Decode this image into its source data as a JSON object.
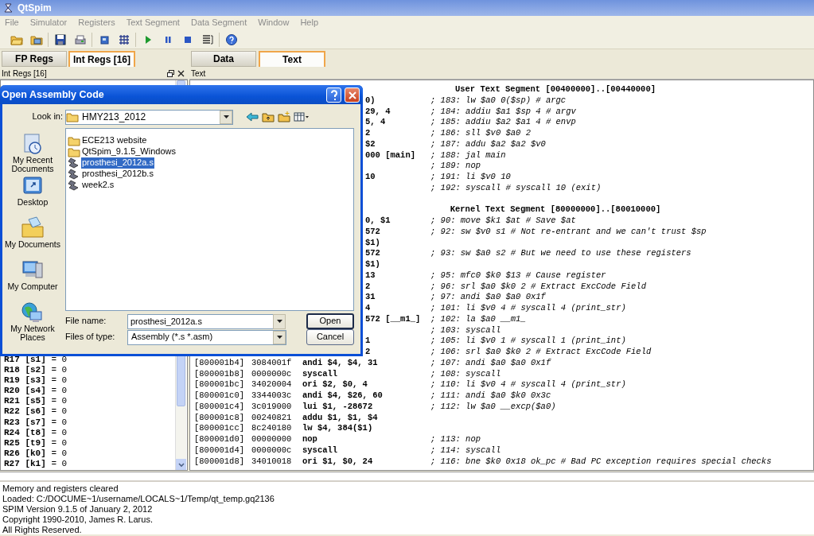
{
  "window": {
    "title": "QtSpim"
  },
  "menu": [
    "File",
    "Simulator",
    "Registers",
    "Text Segment",
    "Data Segment",
    "Window",
    "Help"
  ],
  "register_tabs": [
    {
      "label": "FP Regs",
      "selected": false
    },
    {
      "label": "Int Regs [16]",
      "selected": true
    }
  ],
  "view_tabs": [
    {
      "label": "Data",
      "selected": false
    },
    {
      "label": "Text",
      "selected": true
    }
  ],
  "register_panel": {
    "title": "Int Regs [16]",
    "registers": [
      "**R17 [s1]** = 0",
      "**R18 [s2]** = 0",
      "**R19 [s3]** = 0",
      "**R20 [s4]** = 0",
      "**R21 [s5]** = 0",
      "**R22 [s6]** = 0",
      "**R23 [s7]** = 0",
      "**R24 [t8]** = 0",
      "**R25 [t9]** = 0",
      "**R26 [k0]** = 0",
      "**R27 [k1]** = 0"
    ]
  },
  "text_panel": {
    "title": "Text",
    "lines": [
      {
        "kind": "heading",
        "text": "User Text Segment [00400000]..[00440000]"
      },
      {
        "kind": "partial",
        "fragment": "0)",
        "comment": "; 183: lw $a0 0($sp) # argc"
      },
      {
        "kind": "partial",
        "fragment": "29, 4",
        "comment": "; 184: addiu $a1 $sp 4 # argv"
      },
      {
        "kind": "partial",
        "fragment": "5, 4",
        "comment": "; 185: addiu $a2 $a1 4 # envp"
      },
      {
        "kind": "partial",
        "fragment": "2",
        "comment": "; 186: sll $v0 $a0 2"
      },
      {
        "kind": "partial",
        "fragment": "$2",
        "comment": "; 187: addu $a2 $a2 $v0"
      },
      {
        "kind": "partial",
        "fragment": "000 [main]",
        "comment": "; 188: jal main"
      },
      {
        "kind": "partial",
        "comment": "; 189: nop"
      },
      {
        "kind": "partial",
        "fragment": "10",
        "comment": "; 191: li $v0 10"
      },
      {
        "kind": "partial",
        "comment": "; 192: syscall # syscall 10 (exit)"
      },
      {
        "kind": "blank"
      },
      {
        "kind": "heading",
        "text": "Kernel Text Segment [80000000]..[80010000]"
      },
      {
        "kind": "partial",
        "fragment": "0, $1",
        "comment": "; 90: move $k1 $at # Save $at"
      },
      {
        "kind": "partial",
        "fragment": "572",
        "comment": "; 92: sw $v0 s1 # Not re-entrant and we can't trust $sp"
      },
      {
        "kind": "partial",
        "fragment": "$1)"
      },
      {
        "kind": "partial",
        "fragment": "572",
        "comment": "; 93: sw $a0 s2 # But we need to use these registers"
      },
      {
        "kind": "partial",
        "fragment": "$1)"
      },
      {
        "kind": "partial",
        "fragment": "13",
        "comment": "; 95: mfc0 $k0 $13 # Cause register"
      },
      {
        "kind": "partial",
        "fragment": "2",
        "comment": "; 96: srl $a0 $k0 2 # Extract ExcCode Field"
      },
      {
        "kind": "partial",
        "fragment": "31",
        "comment": "; 97: andi $a0 $a0 0x1f"
      },
      {
        "kind": "partial",
        "fragment": "4",
        "comment": "; 101: li $v0 4 # syscall 4 (print_str)"
      },
      {
        "kind": "partial",
        "fragment": "572 [__m1_]",
        "comment": "; 102: la $a0 __m1_"
      },
      {
        "kind": "partial",
        "comment": "; 103: syscall"
      },
      {
        "kind": "partial",
        "fragment": "1",
        "comment": "; 105: li $v0 1 # syscall 1 (print_int)"
      },
      {
        "kind": "partial",
        "fragment": "2",
        "comment": "; 106: srl $a0 $k0 2 # Extract ExcCode Field"
      },
      {
        "kind": "full",
        "address": "[800001b4]",
        "code": "3084001f",
        "instruction": "andi $4, $4, 31",
        "comment": "; 107: andi $a0 $a0 0x1f"
      },
      {
        "kind": "full",
        "address": "[800001b8]",
        "code": "0000000c",
        "instruction": "syscall",
        "comment": "; 108: syscall"
      },
      {
        "kind": "full",
        "address": "[800001bc]",
        "code": "34020004",
        "instruction": "ori $2, $0, 4",
        "comment": "; 110: li $v0 4 # syscall 4 (print_str)"
      },
      {
        "kind": "full",
        "address": "[800001c0]",
        "code": "3344003c",
        "instruction": "andi $4, $26, 60",
        "comment": "; 111: andi $a0 $k0 0x3c"
      },
      {
        "kind": "full",
        "address": "[800001c4]",
        "code": "3c019000",
        "instruction": "lui $1, -28672",
        "comment": "; 112: lw $a0 __excp($a0)"
      },
      {
        "kind": "full",
        "address": "[800001c8]",
        "code": "00240821",
        "instruction": "addu $1, $1, $4"
      },
      {
        "kind": "full",
        "address": "[800001cc]",
        "code": "8c240180",
        "instruction": "lw $4, 384($1)"
      },
      {
        "kind": "full",
        "address": "[800001d0]",
        "code": "00000000",
        "instruction": "nop",
        "comment": "; 113: nop"
      },
      {
        "kind": "full",
        "address": "[800001d4]",
        "code": "0000000c",
        "instruction": "syscall",
        "comment": "; 114: syscall"
      },
      {
        "kind": "full",
        "address": "[800001d8]",
        "code": "34010018",
        "instruction": "ori $1, $0, 24",
        "comment": "; 116: bne $k0 0x18 ok_pc # Bad PC exception requires special checks"
      }
    ]
  },
  "messages": [
    "Memory and registers cleared",
    "Loaded: C:/DOCUME~1/username/LOCALS~1/Temp/qt_temp.gq2136",
    "SPIM Version 9.1.5 of January 2, 2012",
    "Copyright 1990-2010, James R. Larus.",
    "All Rights Reserved."
  ],
  "dialog": {
    "title": "Open Assembly Code",
    "look_in_label": "Look in:",
    "look_in": "HMY213_2012",
    "places": [
      {
        "kind": "recent",
        "label": "My Recent Documents"
      },
      {
        "kind": "desktop",
        "label": "Desktop"
      },
      {
        "kind": "documents",
        "label": "My Documents"
      },
      {
        "kind": "computer",
        "label": "My Computer"
      },
      {
        "kind": "network",
        "label": "My Network Places"
      }
    ],
    "files": [
      {
        "kind": "folder",
        "name": "ECE213 website",
        "selected": false
      },
      {
        "kind": "folder",
        "name": "QtSpim_9.1.5_Windows",
        "selected": false
      },
      {
        "kind": "file",
        "name": "prosthesi_2012a.s",
        "selected": true
      },
      {
        "kind": "file",
        "name": "prosthesi_2012b.s",
        "selected": false
      },
      {
        "kind": "file",
        "name": "week2.s",
        "selected": false
      }
    ],
    "file_name_label": "File name:",
    "file_name": "prosthesi_2012a.s",
    "file_type_label": "Files of type:",
    "file_type": "Assembly (*.s *.asm)",
    "buttons": [
      {
        "label": "Open",
        "default": true
      },
      {
        "label": "Cancel",
        "default": false
      }
    ]
  }
}
